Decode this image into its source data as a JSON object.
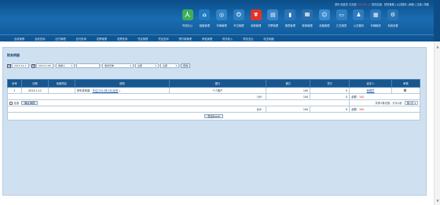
{
  "top_links": {
    "prefix": "您好 收费员  今天是",
    "date": "2013-01-10",
    "middle": " 您的位置：财务管理 | 公共模块   |   刷新  |   注销  |   帮助"
  },
  "toolbar": {
    "items": [
      {
        "label": "内勤办公",
        "icon": "people-icon",
        "color": "#3fae5a",
        "glyph": "人"
      },
      {
        "label": "租客管理",
        "icon": "house-icon",
        "color": "#1f7cc4",
        "glyph": "⌂"
      },
      {
        "label": "车辆管理",
        "icon": "car-icon",
        "color": "#2e84c7",
        "glyph": "◎"
      },
      {
        "label": "车位管理",
        "icon": "power-icon",
        "color": "#2d7fc0",
        "glyph": "⏻"
      },
      {
        "label": "收款管理",
        "icon": "money-icon",
        "color": "#e0332a",
        "glyph": "¥"
      },
      {
        "label": "开票管理",
        "icon": "document-icon",
        "color": "#3b86c9",
        "glyph": "▤"
      },
      {
        "label": "报表管理",
        "icon": "book-icon",
        "color": "#2b74b8",
        "glyph": "▮"
      },
      {
        "label": "账单管理",
        "icon": "meter-icon",
        "color": "#2b6fae",
        "glyph": "Ⅲ"
      },
      {
        "label": "设备管理",
        "icon": "person-card-icon",
        "color": "#3a8ad0",
        "glyph": "☺"
      },
      {
        "label": "汇总报表",
        "icon": "monitor-icon",
        "color": "#2f7fc2",
        "glyph": "▭"
      },
      {
        "label": "公共模块",
        "icon": "group-icon",
        "color": "#2e7bc0",
        "glyph": "♟"
      },
      {
        "label": "车辆模块",
        "icon": "grid-icon",
        "color": "#2b77ba",
        "glyph": "▦"
      },
      {
        "label": "系统设置",
        "icon": "settings-icon",
        "color": "#2a74b5",
        "glyph": "⚙"
      }
    ]
  },
  "nav": [
    "应收管理",
    "应收查询",
    "应付管理",
    "应付查询",
    "发票管理",
    "发票查询",
    "凭证管理",
    "凭证查询",
    "预付款管理",
    "押金管理",
    "财务收入",
    "财务支出",
    "收支明细"
  ],
  "page": {
    "title": "财务明细"
  },
  "filter": {
    "date_from": "2013-11-1",
    "date_to": "2013-2-28",
    "type_select": "收单人",
    "name_input": "",
    "category_select": "收款凭单",
    "status_select": "全部",
    "scope_select": "全部",
    "search_label": "查询"
  },
  "table": {
    "headers": [
      "序号",
      "日期",
      "收款项目",
      "说明",
      "银行",
      "借方",
      "贷方",
      "经手人",
      "审核"
    ],
    "row": {
      "index": "1",
      "date": "2014-1-12",
      "project": "",
      "desc_prefix": "停车费收缴：",
      "desc_link": "车位(2014年1月)应收",
      "desc_suffix": " )",
      "bank": "个人账户",
      "debit": "100",
      "credit": "0",
      "handler": "管理员"
    },
    "subtotal_label": "小计：",
    "subtotal_debit": "100",
    "subtotal_credit": "0",
    "balance_label": "余额：",
    "balance_value": "100",
    "select_all_label": "全选",
    "confirm_label": "确认审核",
    "page_info": "共有1条记录，分为1页",
    "page_select": "第1页",
    "total_label": "合计：",
    "total_debit": "100",
    "total_credit": "0",
    "total_balance_label": "余额：",
    "total_balance_value": "100",
    "export_label": "导出Excel"
  }
}
